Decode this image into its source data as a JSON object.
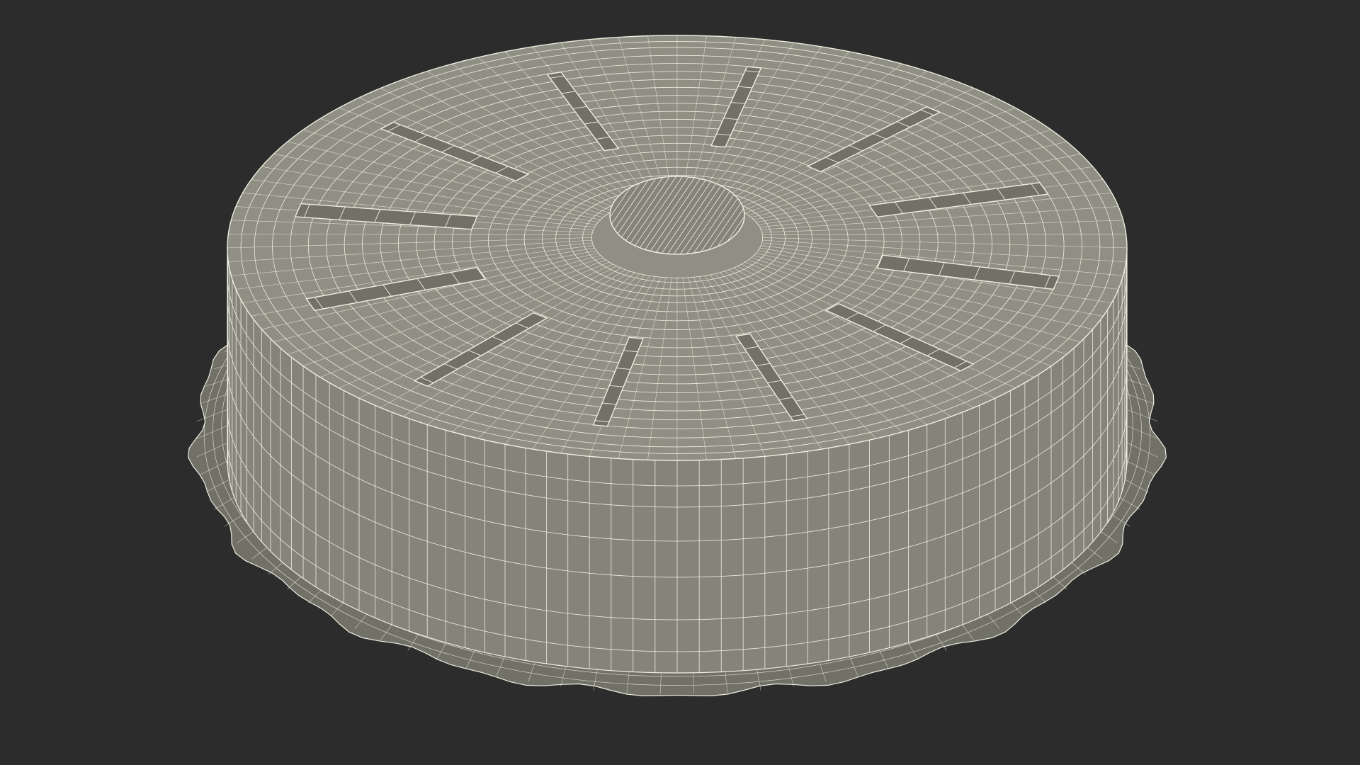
{
  "scene": {
    "subject": "wireframe-mesh-render",
    "colors": {
      "background": "#2c2c2c",
      "surface": "#84847a",
      "surface_dark": "#717168",
      "surface_light": "#8f8f84",
      "wire": "#eeeee0"
    }
  }
}
